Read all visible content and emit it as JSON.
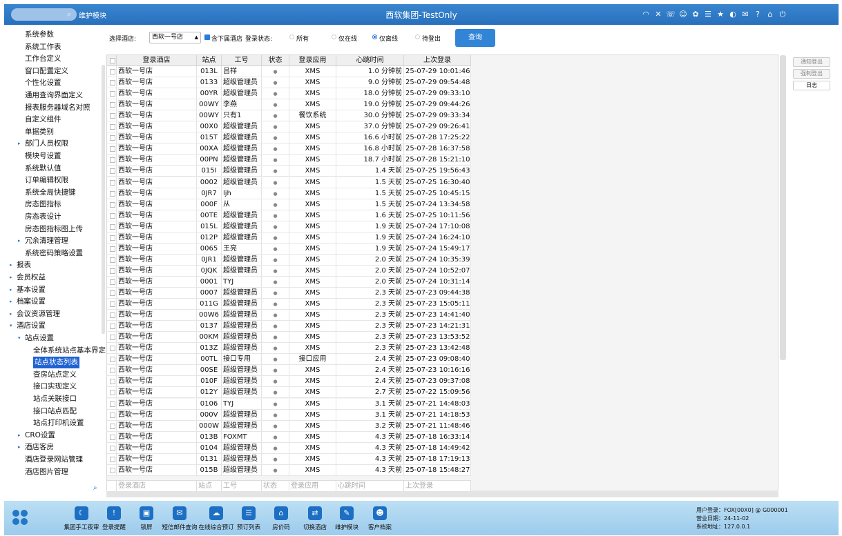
{
  "topbar": {
    "search_icon": "search-icon",
    "module_title": "维护模块",
    "title": "西软集团-TestOnly",
    "icons": [
      "wifi-icon",
      "tools-icon",
      "phone-icon",
      "service-icon",
      "palette-icon",
      "menu-icon",
      "star-icon",
      "contrast-icon",
      "mail-icon",
      "help-icon",
      "home-icon",
      "power-icon"
    ]
  },
  "sidebar": {
    "items": [
      {
        "label": "系统参数",
        "level": 2,
        "arrow": ""
      },
      {
        "label": "系统工作表",
        "level": 2,
        "arrow": ""
      },
      {
        "label": "工作台定义",
        "level": 2,
        "arrow": ""
      },
      {
        "label": "窗口配置定义",
        "level": 2,
        "arrow": ""
      },
      {
        "label": "个性化设置",
        "level": 2,
        "arrow": ""
      },
      {
        "label": "通用查询界面定义",
        "level": 2,
        "arrow": ""
      },
      {
        "label": "报表服务器域名对照",
        "level": 2,
        "arrow": ""
      },
      {
        "label": "自定义组件",
        "level": 2,
        "arrow": ""
      },
      {
        "label": "单据类别",
        "level": 2,
        "arrow": ""
      },
      {
        "label": "部门人员权限",
        "level": 2,
        "arrow": "▸"
      },
      {
        "label": "模块号设置",
        "level": 2,
        "arrow": ""
      },
      {
        "label": "系统默认值",
        "level": 2,
        "arrow": ""
      },
      {
        "label": "订单编辑权限",
        "level": 2,
        "arrow": ""
      },
      {
        "label": "系统全局快捷键",
        "level": 2,
        "arrow": ""
      },
      {
        "label": "房态图指标",
        "level": 2,
        "arrow": ""
      },
      {
        "label": "房态表设计",
        "level": 2,
        "arrow": ""
      },
      {
        "label": "房态图指标图上传",
        "level": 2,
        "arrow": ""
      },
      {
        "label": "冗余清理管理",
        "level": 2,
        "arrow": "▸"
      },
      {
        "label": "系统密码策略设置",
        "level": 2,
        "arrow": ""
      },
      {
        "label": "报表",
        "level": 1,
        "arrow": "▸"
      },
      {
        "label": "会员权益",
        "level": 1,
        "arrow": "▸"
      },
      {
        "label": "基本设置",
        "level": 1,
        "arrow": "▸"
      },
      {
        "label": "档案设置",
        "level": 1,
        "arrow": "▸"
      },
      {
        "label": "会议资源管理",
        "level": 1,
        "arrow": "▸"
      },
      {
        "label": "酒店设置",
        "level": 1,
        "arrow": "▾"
      },
      {
        "label": "站点设置",
        "level": 2,
        "arrow": "▾"
      },
      {
        "label": "全体系统站点基本界定",
        "level": 3,
        "arrow": ""
      },
      {
        "label": "站点状态列表",
        "level": 3,
        "arrow": "",
        "selected": true
      },
      {
        "label": "查房站点定义",
        "level": 3,
        "arrow": ""
      },
      {
        "label": "接口实现定义",
        "level": 3,
        "arrow": ""
      },
      {
        "label": "站点关联接口",
        "level": 3,
        "arrow": ""
      },
      {
        "label": "接口站点匹配",
        "level": 3,
        "arrow": ""
      },
      {
        "label": "站点打印机设置",
        "level": 3,
        "arrow": ""
      },
      {
        "label": "CRO设置",
        "level": 2,
        "arrow": "▸"
      },
      {
        "label": "酒店客房",
        "level": 2,
        "arrow": "▸"
      },
      {
        "label": "酒店登录网站管理",
        "level": 2,
        "arrow": ""
      },
      {
        "label": "酒店图片管理",
        "level": 2,
        "arrow": ""
      }
    ],
    "search_icon": "search-icon"
  },
  "filters": {
    "hotel_label": "选择酒店:",
    "hotel_value": "西软一号店",
    "include_sub_label": "含下属酒店",
    "include_sub_checked": true,
    "status_label": "登录状态:",
    "radio_all": "所有",
    "radio_online": "仅在线",
    "radio_offline": "仅离线",
    "radio_pending": "待登出",
    "selected_radio": "仅离线",
    "query_button": "查询"
  },
  "side_buttons": {
    "notify_logout": "通知登出",
    "force_logout": "强制登出",
    "log": "日志"
  },
  "table": {
    "headers": [
      "登录酒店",
      "站点",
      "工号",
      "状态",
      "登录应用",
      "心跳时间",
      "上次登录"
    ],
    "rows": [
      [
        "西软一号店",
        "013L",
        "吕祥",
        "●",
        "XMS",
        "1.0 分钟前",
        "25-07-29 10:01:46"
      ],
      [
        "西软一号店",
        "0133",
        "超级管理员",
        "●",
        "XMS",
        "9.0 分钟前",
        "25-07-29 09:54:48"
      ],
      [
        "西软一号店",
        "00YR",
        "超级管理员",
        "●",
        "XMS",
        "18.0 分钟前",
        "25-07-29 09:33:10"
      ],
      [
        "西软一号店",
        "00WY",
        "李燕",
        "●",
        "XMS",
        "19.0 分钟前",
        "25-07-29 09:44:26"
      ],
      [
        "西软一号店",
        "00WY",
        "只有1",
        "●",
        "餐饮系统",
        "30.0 分钟前",
        "25-07-29 09:33:34"
      ],
      [
        "西软一号店",
        "00X0",
        "超级管理员",
        "●",
        "XMS",
        "37.0 分钟前",
        "25-07-29 09:26:41"
      ],
      [
        "西软一号店",
        "015T",
        "超级管理员",
        "●",
        "XMS",
        "16.6 小时前",
        "25-07-28 17:25:22"
      ],
      [
        "西软一号店",
        "00XA",
        "超级管理员",
        "●",
        "XMS",
        "16.8 小时前",
        "25-07-28 16:37:58"
      ],
      [
        "西软一号店",
        "00PN",
        "超级管理员",
        "●",
        "XMS",
        "18.7 小时前",
        "25-07-28 15:21:10"
      ],
      [
        "西软一号店",
        "015I",
        "超级管理员",
        "●",
        "XMS",
        "1.4 天前",
        "25-07-25 19:56:43"
      ],
      [
        "西软一号店",
        "0002",
        "超级管理员",
        "●",
        "XMS",
        "1.5 天前",
        "25-07-25 16:30:40"
      ],
      [
        "西软一号店",
        "0JR7",
        "ljh",
        "●",
        "XMS",
        "1.5 天前",
        "25-07-25 10:45:15"
      ],
      [
        "西软一号店",
        "000F",
        "从",
        "●",
        "XMS",
        "1.5 天前",
        "25-07-24 13:34:58"
      ],
      [
        "西软一号店",
        "00TE",
        "超级管理员",
        "●",
        "XMS",
        "1.6 天前",
        "25-07-25 10:11:56"
      ],
      [
        "西软一号店",
        "015L",
        "超级管理员",
        "●",
        "XMS",
        "1.9 天前",
        "25-07-24 17:10:08"
      ],
      [
        "西软一号店",
        "012P",
        "超级管理员",
        "●",
        "XMS",
        "1.9 天前",
        "25-07-24 16:24:10"
      ],
      [
        "西软一号店",
        "0065",
        "王亮",
        "●",
        "XMS",
        "1.9 天前",
        "25-07-24 15:49:17"
      ],
      [
        "西软一号店",
        "0JR1",
        "超级管理员",
        "●",
        "XMS",
        "2.0 天前",
        "25-07-24 10:35:39"
      ],
      [
        "西软一号店",
        "0JQK",
        "超级管理员",
        "●",
        "XMS",
        "2.0 天前",
        "25-07-24 10:52:07"
      ],
      [
        "西软一号店",
        "0001",
        "TYJ",
        "●",
        "XMS",
        "2.0 天前",
        "25-07-24 10:31:14"
      ],
      [
        "西软一号店",
        "0007",
        "超级管理员",
        "●",
        "XMS",
        "2.3 天前",
        "25-07-23 09:44:38"
      ],
      [
        "西软一号店",
        "011G",
        "超级管理员",
        "●",
        "XMS",
        "2.3 天前",
        "25-07-23 15:05:11"
      ],
      [
        "西软一号店",
        "00W6",
        "超级管理员",
        "●",
        "XMS",
        "2.3 天前",
        "25-07-23 14:41:40"
      ],
      [
        "西软一号店",
        "0137",
        "超级管理员",
        "●",
        "XMS",
        "2.3 天前",
        "25-07-23 14:21:31"
      ],
      [
        "西软一号店",
        "00KM",
        "超级管理员",
        "●",
        "XMS",
        "2.3 天前",
        "25-07-23 13:53:52"
      ],
      [
        "西软一号店",
        "013Z",
        "超级管理员",
        "●",
        "XMS",
        "2.3 天前",
        "25-07-23 13:42:48"
      ],
      [
        "西软一号店",
        "00TL",
        "接口专用",
        "●",
        "接口应用",
        "2.4 天前",
        "25-07-23 09:08:40"
      ],
      [
        "西软一号店",
        "00SE",
        "超级管理员",
        "●",
        "XMS",
        "2.4 天前",
        "25-07-23 10:16:16"
      ],
      [
        "西软一号店",
        "010F",
        "超级管理员",
        "●",
        "XMS",
        "2.4 天前",
        "25-07-23 09:37:08"
      ],
      [
        "西软一号店",
        "012Y",
        "超级管理员",
        "●",
        "XMS",
        "2.7 天前",
        "25-07-22 15:09:56"
      ],
      [
        "西软一号店",
        "0106",
        "TYJ",
        "●",
        "XMS",
        "3.1 天前",
        "25-07-21 14:48:03"
      ],
      [
        "西软一号店",
        "000V",
        "超级管理员",
        "●",
        "XMS",
        "3.1 天前",
        "25-07-21 14:18:53"
      ],
      [
        "西软一号店",
        "000W",
        "超级管理员",
        "●",
        "XMS",
        "3.2 天前",
        "25-07-21 11:48:46"
      ],
      [
        "西软一号店",
        "013B",
        "FOXMT",
        "●",
        "XMS",
        "4.3 天前",
        "25-07-18 16:33:14"
      ],
      [
        "西软一号店",
        "0104",
        "超级管理员",
        "●",
        "XMS",
        "4.3 天前",
        "25-07-18 14:49:42"
      ],
      [
        "西软一号店",
        "0131",
        "超级管理员",
        "●",
        "XMS",
        "4.3 天前",
        "25-07-18 17:19:13"
      ],
      [
        "西软一号店",
        "015B",
        "超级管理员",
        "●",
        "XMS",
        "4.3 天前",
        "25-07-18 15:48:27"
      ]
    ],
    "footer": [
      "登录酒店",
      "站点",
      "工号",
      "状态",
      "登录应用",
      "心跳时间",
      "上次登录"
    ]
  },
  "bottombar": {
    "logo_icon": "logo-icon",
    "buttons": [
      {
        "label": "集团手工夜审",
        "icon": "moon-icon"
      },
      {
        "label": "登录提醒",
        "icon": "alert-icon"
      },
      {
        "label": "锁屏",
        "icon": "lock-icon"
      },
      {
        "label": "短信邮件查询",
        "icon": "mail-icon"
      },
      {
        "label": "在线综合预订",
        "icon": "cloud-icon"
      },
      {
        "label": "预订列表",
        "icon": "list-icon"
      },
      {
        "label": "房价码",
        "icon": "house-icon"
      },
      {
        "label": "切换酒店",
        "icon": "switch-icon"
      },
      {
        "label": "维护模块",
        "icon": "wrench-icon"
      },
      {
        "label": "客户档案",
        "icon": "profile-icon"
      }
    ],
    "info": {
      "user_label": "用户登录：",
      "user_value": "FOX[00X0] @ G000001",
      "date_label": "营业日期：",
      "date_value": "24-11-02",
      "addr_label": "系统地址：",
      "addr_value": "127.0.0.1"
    }
  },
  "colors": {
    "topbar": "#2f7cc9",
    "accent": "#3285d6",
    "selected": "#1f62d2",
    "bottombar": "#a9d4ee"
  }
}
